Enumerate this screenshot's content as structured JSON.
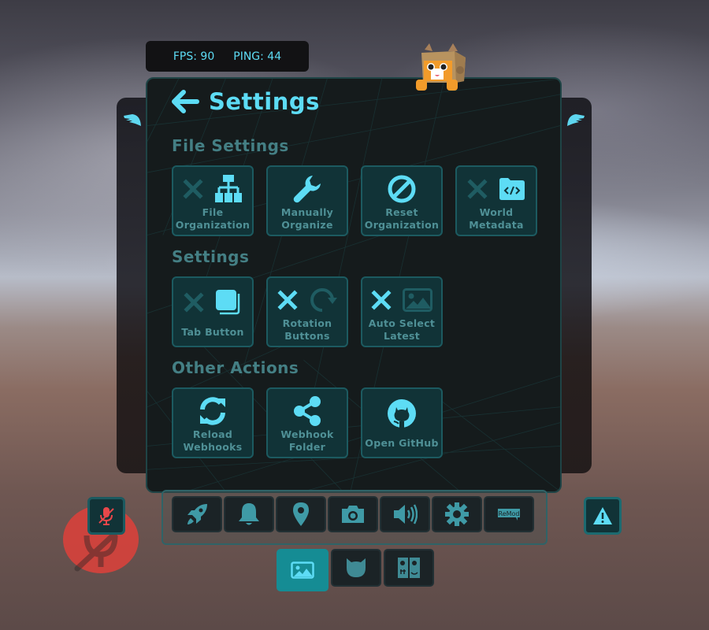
{
  "stats": {
    "fps": "FPS: 90",
    "ping": "PING: 44"
  },
  "panel": {
    "title": "Settings",
    "back_icon": "arrow-left-icon",
    "sections": [
      {
        "title": "File Settings",
        "buttons": [
          {
            "label": "File\nOrganization",
            "icons": [
              "x-icon-disabled",
              "sitemap-icon"
            ]
          },
          {
            "label": "Manually\nOrganize",
            "icons": [
              "wrench-icon"
            ]
          },
          {
            "label": "Reset\nOrganization",
            "icons": [
              "ban-icon"
            ]
          },
          {
            "label": "World\nMetadata",
            "icons": [
              "x-icon-disabled",
              "folder-code-icon"
            ]
          }
        ]
      },
      {
        "title": "Settings",
        "buttons": [
          {
            "label": "Tab Button",
            "icons": [
              "x-icon-disabled",
              "clone-icon"
            ]
          },
          {
            "label": "Rotation\nButtons",
            "icons": [
              "x-icon-active",
              "rotate-icon-disabled"
            ]
          },
          {
            "label": "Auto Select\nLatest",
            "icons": [
              "x-icon-active",
              "image-icon-disabled"
            ]
          }
        ]
      },
      {
        "title": "Other Actions",
        "buttons": [
          {
            "label": "Reload\nWebhooks",
            "icons": [
              "sync-icon"
            ]
          },
          {
            "label": "Webhook\nFolder",
            "icons": [
              "share-icon"
            ]
          },
          {
            "label": "Open GitHub",
            "icons": [
              "github-icon"
            ]
          }
        ]
      }
    ]
  },
  "dock": {
    "items": [
      {
        "name": "rocket",
        "icon": "rocket-icon"
      },
      {
        "name": "notifications",
        "icon": "bell-icon"
      },
      {
        "name": "location",
        "icon": "map-pin-icon"
      },
      {
        "name": "camera",
        "icon": "camera-icon"
      },
      {
        "name": "audio",
        "icon": "volume-icon"
      },
      {
        "name": "settings",
        "icon": "gear-icon"
      },
      {
        "name": "remod",
        "icon": "remod-icon",
        "text": "ReMod"
      }
    ],
    "sub_items": [
      {
        "name": "gallery",
        "icon": "image-icon",
        "active": true
      },
      {
        "name": "avatar",
        "icon": "cat-head-icon",
        "active": false
      },
      {
        "name": "emotes",
        "icon": "faces-icon",
        "active": false
      }
    ]
  },
  "mute": {
    "icon": "microphone-slash-icon",
    "state": "muted"
  },
  "warning": {
    "icon": "warning-triangle-icon"
  },
  "colors": {
    "accent": "#5ddcf5",
    "tile_bg": "#113337",
    "tile_border": "#1c5a60",
    "muted_label": "#4f9096",
    "active_tab": "#158c94",
    "mute_red": "#d8423c"
  }
}
